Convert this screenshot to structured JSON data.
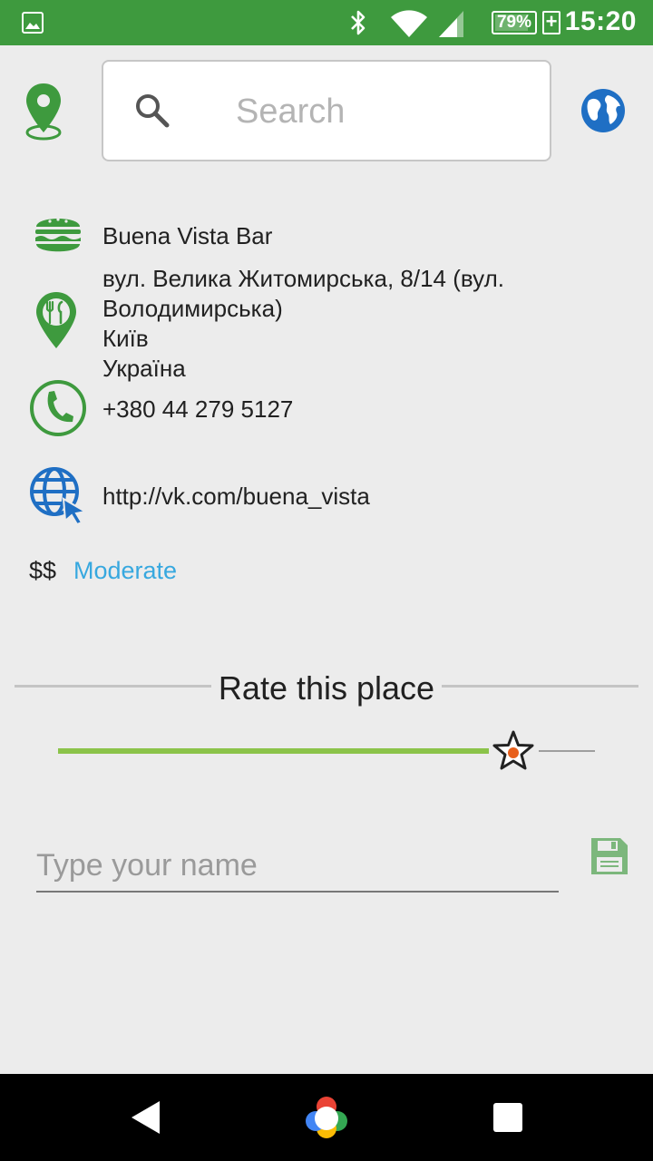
{
  "status_bar": {
    "time": "15:20",
    "battery_percent": "79%",
    "icons": [
      "image-icon",
      "bluetooth-icon",
      "wifi-icon",
      "signal-icon",
      "battery-icon",
      "charging-plus-icon"
    ]
  },
  "header": {
    "left_icon": "location-pin-icon",
    "search_placeholder": "Search",
    "right_icon": "globe-icon"
  },
  "place": {
    "name": "Buena Vista Bar",
    "address_lines": [
      "вул. Велика Житомирська, 8/14 (вул.",
      "Володимирська)",
      "Київ",
      "Україна"
    ],
    "phone": "+380 44 279 5127",
    "website": "http://vk.com/buena_vista",
    "price_symbol": "$$",
    "price_level": "Moderate"
  },
  "rating": {
    "title": "Rate this place",
    "value_fraction": 0.9
  },
  "name_field": {
    "placeholder": "Type your name"
  },
  "colors": {
    "status_bar": "#3e9a3e",
    "icon_green": "#3e9a3e",
    "link_blue": "#37a8df",
    "slider_green": "#8bc34a",
    "globe_blue": "#1f6fc4",
    "save_green": "#7cb77c"
  }
}
